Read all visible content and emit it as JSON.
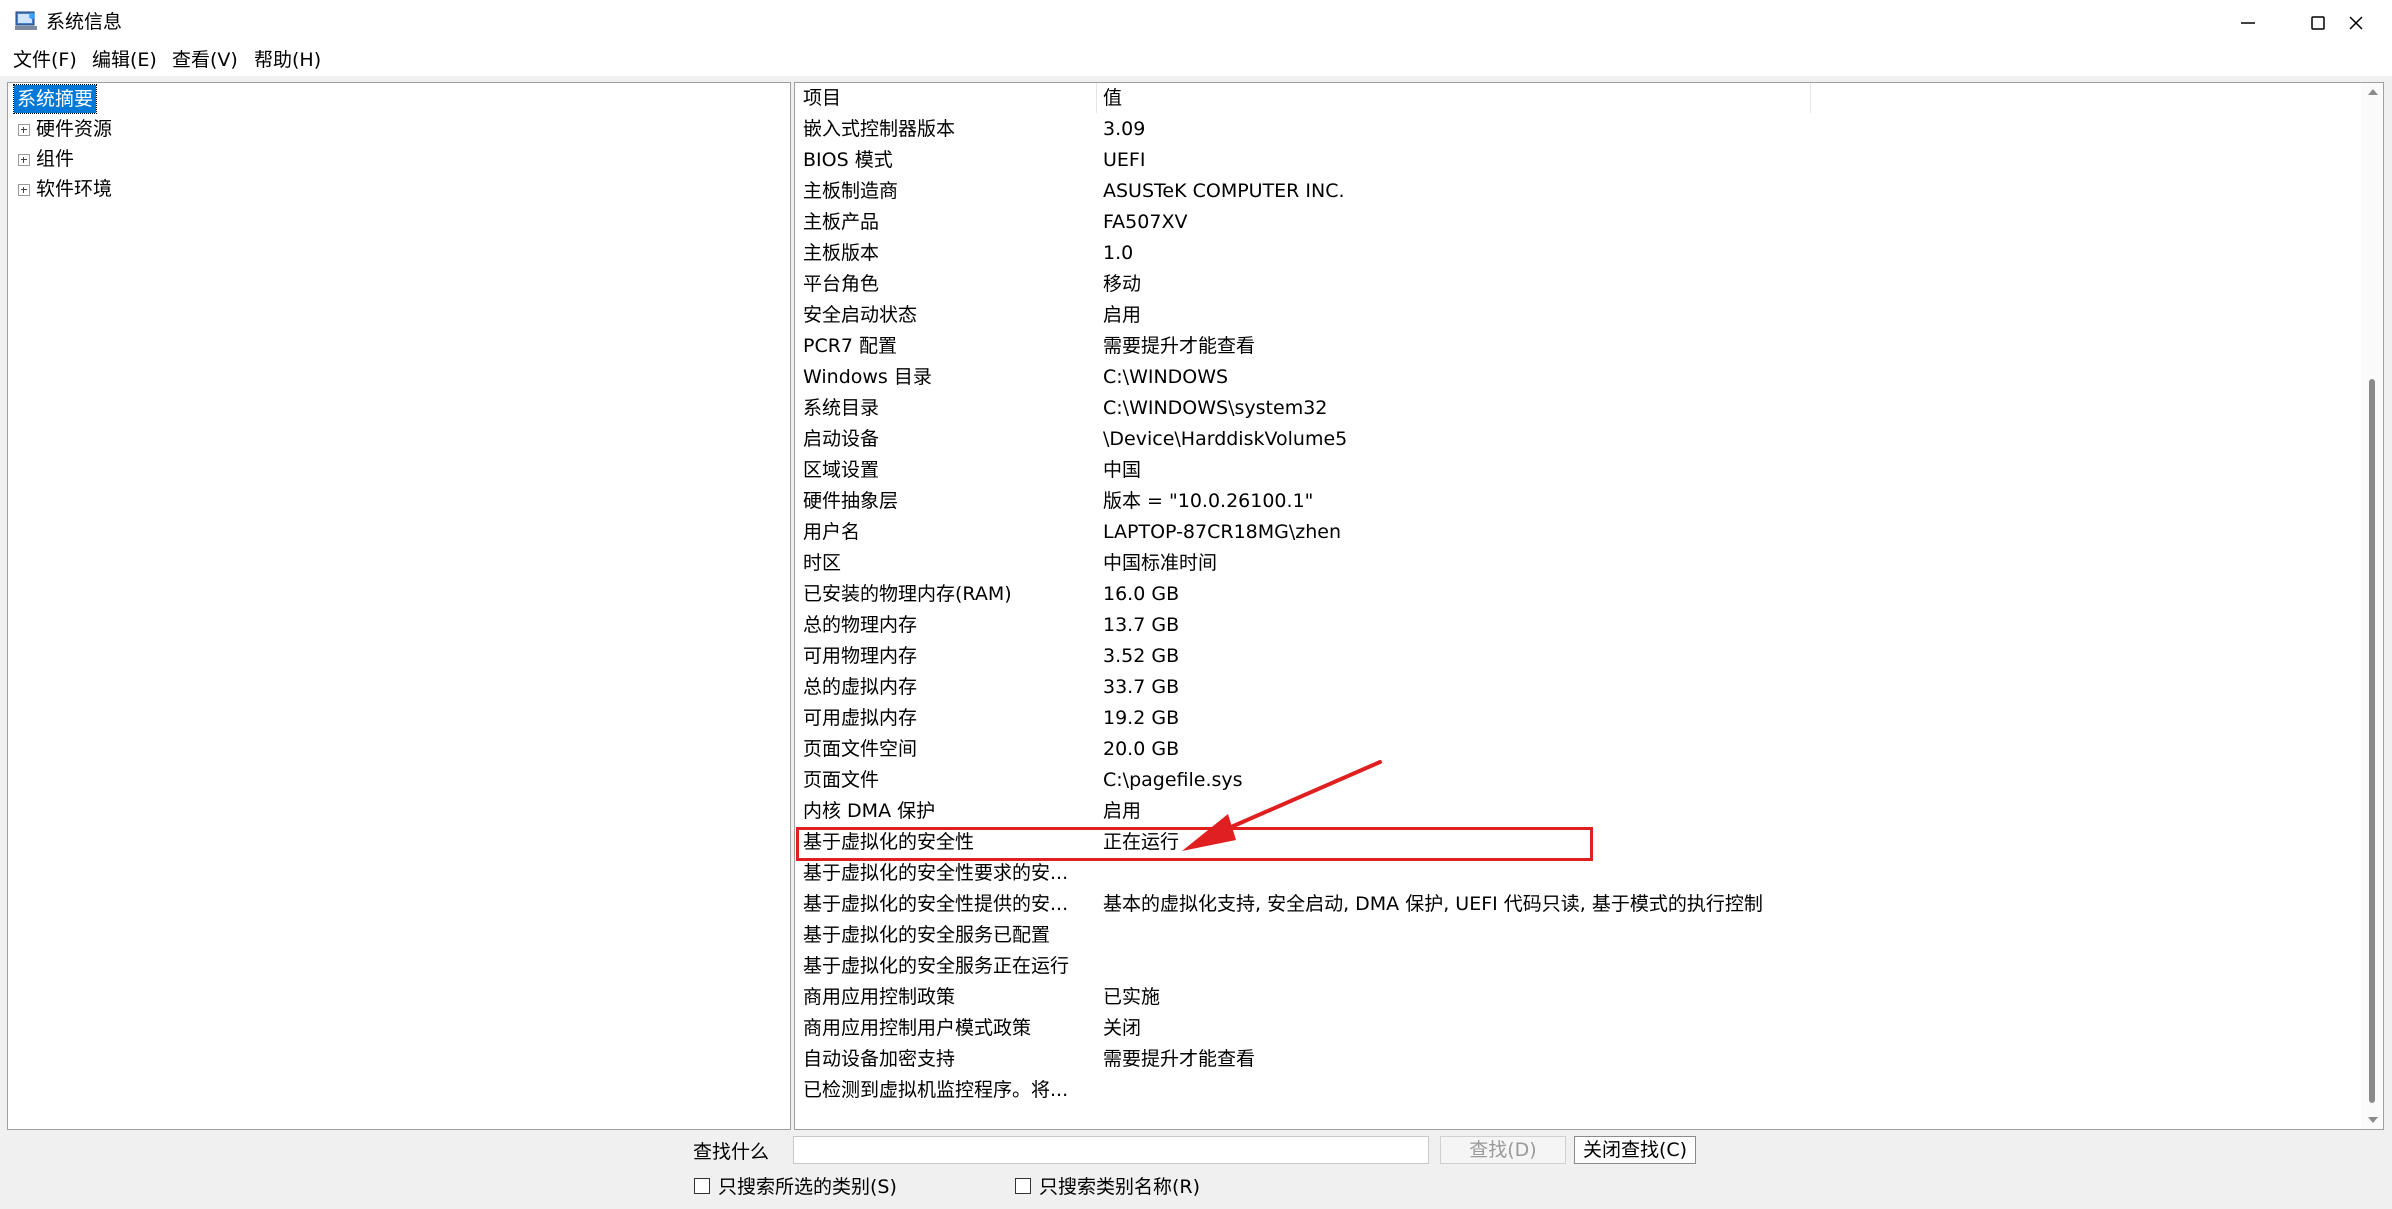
{
  "window": {
    "title": "系统信息"
  },
  "menu": [
    "文件(F)",
    "编辑(E)",
    "查看(V)",
    "帮助(H)"
  ],
  "tree": {
    "selected": "系统摘要",
    "children": [
      "硬件资源",
      "组件",
      "软件环境"
    ]
  },
  "list": {
    "columns": [
      "项目",
      "值"
    ],
    "rows": [
      {
        "item": "嵌入式控制器版本",
        "value": "3.09"
      },
      {
        "item": "BIOS 模式",
        "value": "UEFI"
      },
      {
        "item": "主板制造商",
        "value": "ASUSTeK COMPUTER INC."
      },
      {
        "item": "主板产品",
        "value": "FA507XV"
      },
      {
        "item": "主板版本",
        "value": "1.0"
      },
      {
        "item": "平台角色",
        "value": "移动"
      },
      {
        "item": "安全启动状态",
        "value": "启用"
      },
      {
        "item": "PCR7 配置",
        "value": "需要提升才能查看"
      },
      {
        "item": "Windows 目录",
        "value": "C:\\WINDOWS"
      },
      {
        "item": "系统目录",
        "value": "C:\\WINDOWS\\system32"
      },
      {
        "item": "启动设备",
        "value": "\\Device\\HarddiskVolume5"
      },
      {
        "item": "区域设置",
        "value": "中国"
      },
      {
        "item": "硬件抽象层",
        "value": "版本 = \"10.0.26100.1\""
      },
      {
        "item": "用户名",
        "value": "LAPTOP-87CR18MG\\zhen"
      },
      {
        "item": "时区",
        "value": "中国标准时间"
      },
      {
        "item": "已安装的物理内存(RAM)",
        "value": "16.0 GB"
      },
      {
        "item": "总的物理内存",
        "value": "13.7 GB"
      },
      {
        "item": "可用物理内存",
        "value": "3.52 GB"
      },
      {
        "item": "总的虚拟内存",
        "value": "33.7 GB"
      },
      {
        "item": "可用虚拟内存",
        "value": "19.2 GB"
      },
      {
        "item": "页面文件空间",
        "value": "20.0 GB"
      },
      {
        "item": "页面文件",
        "value": "C:\\pagefile.sys"
      },
      {
        "item": "内核 DMA 保护",
        "value": "启用"
      },
      {
        "item": "基于虚拟化的安全性",
        "value": "正在运行"
      },
      {
        "item": "基于虚拟化的安全性要求的安...",
        "value": ""
      },
      {
        "item": "基于虚拟化的安全性提供的安...",
        "value": "基本的虚拟化支持, 安全启动, DMA 保护, UEFI 代码只读, 基于模式的执行控制"
      },
      {
        "item": "基于虚拟化的安全服务已配置",
        "value": ""
      },
      {
        "item": "基于虚拟化的安全服务正在运行",
        "value": ""
      },
      {
        "item": "商用应用控制政策",
        "value": "已实施"
      },
      {
        "item": "商用应用控制用户模式政策",
        "value": "关闭"
      },
      {
        "item": "自动设备加密支持",
        "value": "需要提升才能查看"
      },
      {
        "item": "已检测到虚拟机监控程序。将...",
        "value": ""
      }
    ],
    "highlighted_item": "基于虚拟化的安全性"
  },
  "find": {
    "label": "查找什么",
    "input_value": "",
    "find_button": "查找(D)",
    "close_find_button": "关闭查找(C)",
    "only_selected_category": "只搜索所选的类别(S)",
    "only_category_names": "只搜索类别名称(R)"
  },
  "colors": {
    "selection": "#0078d7",
    "annotation": "#e02020"
  }
}
